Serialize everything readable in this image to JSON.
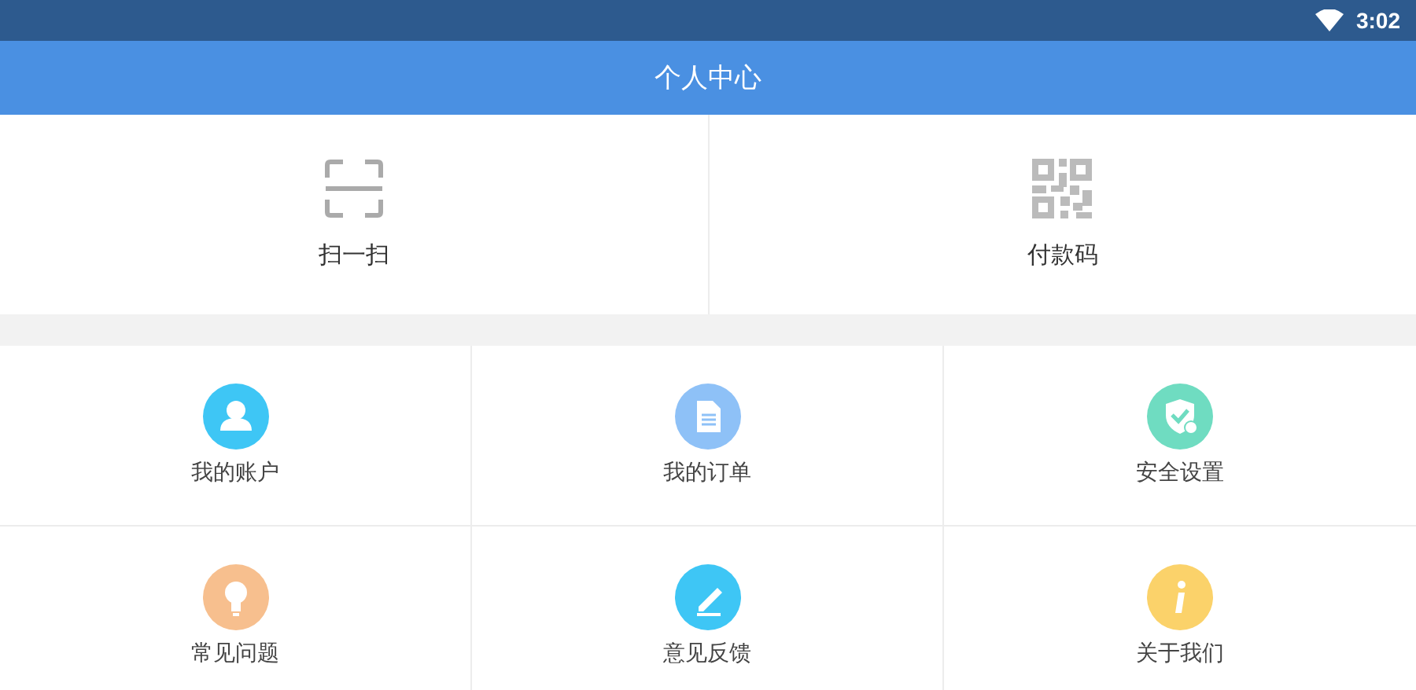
{
  "status_bar": {
    "time": "3:02"
  },
  "header": {
    "title": "个人中心"
  },
  "quick_actions": [
    {
      "kind": "scan",
      "label": "扫一扫"
    },
    {
      "kind": "qrcode",
      "label": "付款码"
    }
  ],
  "menu": [
    {
      "kind": "user",
      "label": "我的账户",
      "color": "#3ec6f5"
    },
    {
      "kind": "document",
      "label": "我的订单",
      "color": "#8ec1f7"
    },
    {
      "kind": "shield",
      "label": "安全设置",
      "color": "#6fdcc1"
    },
    {
      "kind": "bulb",
      "label": "常见问题",
      "color": "#f7bf8e"
    },
    {
      "kind": "pen",
      "label": "意见反馈",
      "color": "#3ec6f5"
    },
    {
      "kind": "info",
      "label": "关于我们",
      "color": "#fbd26a"
    }
  ]
}
